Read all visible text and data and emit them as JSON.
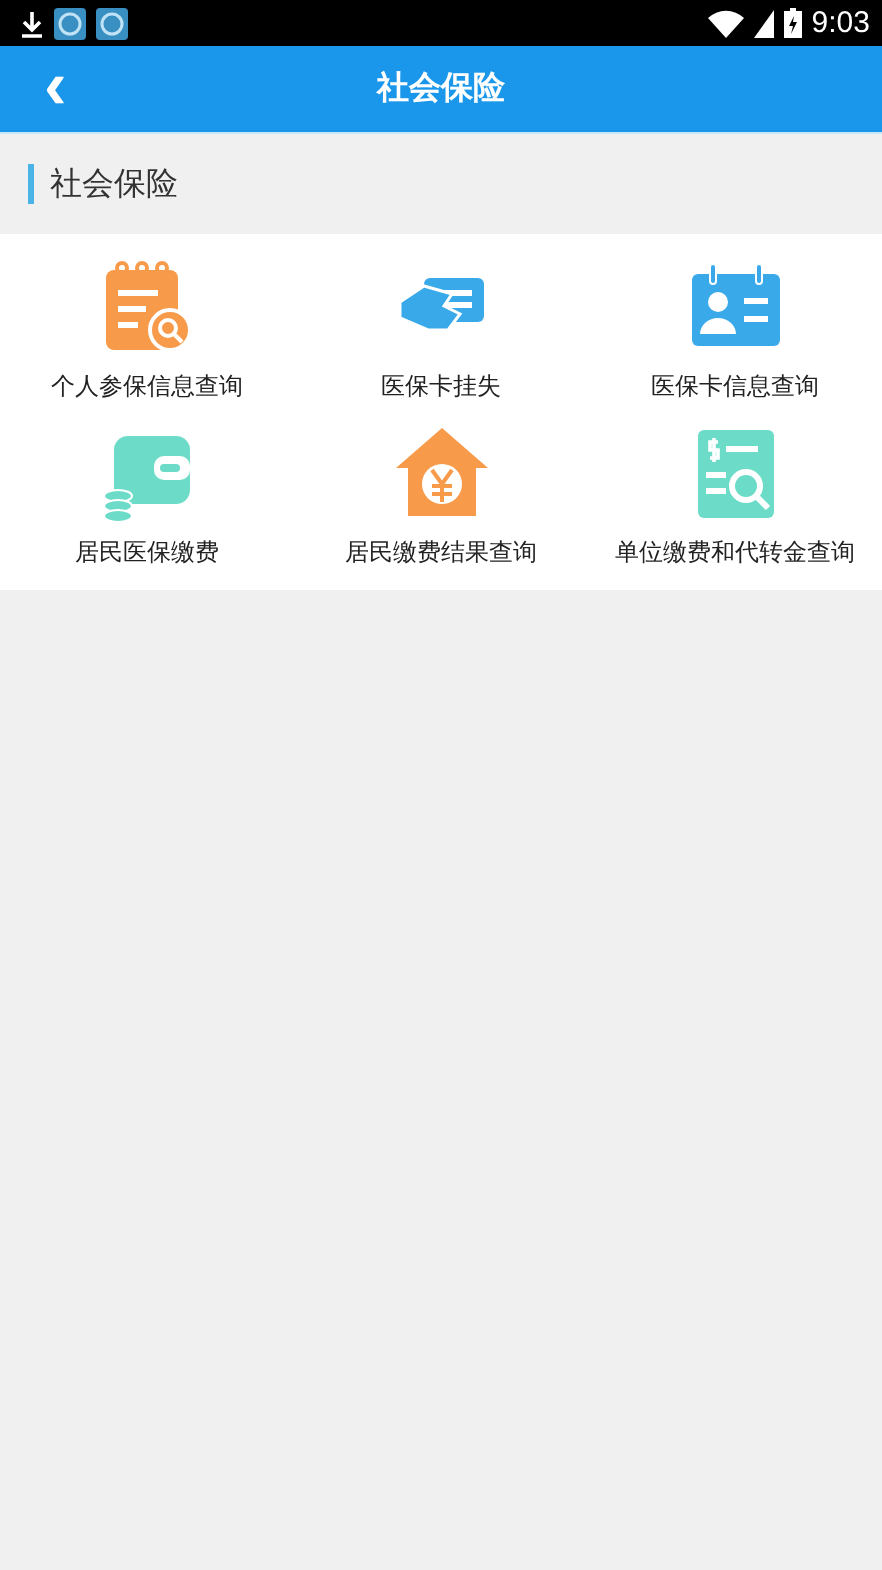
{
  "status_bar": {
    "time": "9:03"
  },
  "header": {
    "title": "社会保险",
    "back_icon": "‹"
  },
  "section": {
    "title": "社会保险"
  },
  "items": [
    {
      "label": "个人参保信息查询",
      "kind": "calendar-search",
      "color": "#f79a4a"
    },
    {
      "label": "医保卡挂失",
      "kind": "card-hand",
      "color": "#3aa9ea"
    },
    {
      "label": "医保卡信息查询",
      "kind": "id-card",
      "color": "#3aa9ea"
    },
    {
      "label": "居民医保缴费",
      "kind": "wallet",
      "color": "#6cdcc8"
    },
    {
      "label": "居民缴费结果查询",
      "kind": "house-yen",
      "color": "#f79a4a"
    },
    {
      "label": "单位缴费和代转金查询",
      "kind": "receipt-search",
      "color": "#6cdcc8"
    }
  ]
}
